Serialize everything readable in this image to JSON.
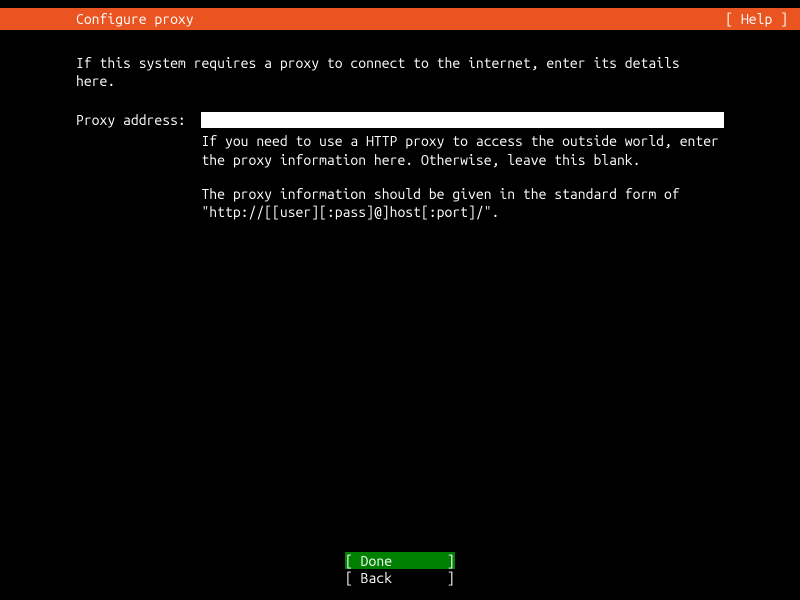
{
  "header": {
    "title": "Configure proxy",
    "help": "[ Help ]"
  },
  "content": {
    "intro": "If this system requires a proxy to connect to the internet, enter its details here.",
    "form": {
      "label": "Proxy address:  ",
      "value": "",
      "help1": "If you need to use a HTTP proxy to access the outside world, enter the proxy information here. Otherwise, leave this blank.",
      "help2": "The proxy information should be given in the standard form of \"http://[[user][:pass]@]host[:port]/\"."
    }
  },
  "buttons": {
    "done": "[ Done       ]",
    "back": "[ Back       ]"
  }
}
